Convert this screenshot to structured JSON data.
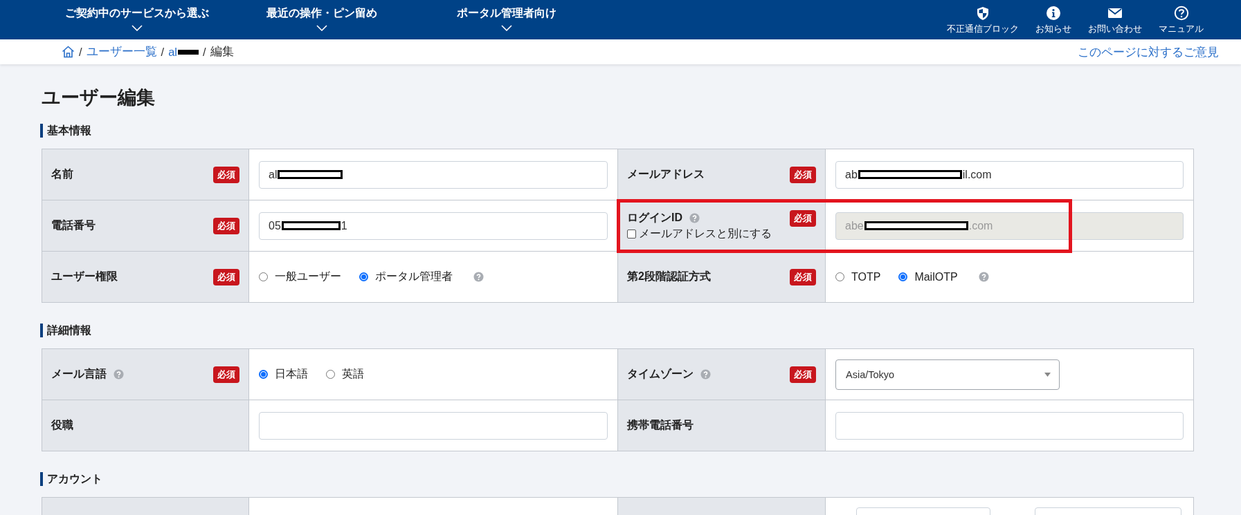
{
  "header": {
    "nav": [
      {
        "label": "ご契約中のサービスから選ぶ"
      },
      {
        "label": "最近の操作・ピン留め"
      },
      {
        "label": "ポータル管理者向け"
      }
    ],
    "utilities": [
      {
        "kind": "shield",
        "label": "不正通信ブロック"
      },
      {
        "kind": "info",
        "label": "お知らせ"
      },
      {
        "kind": "mail",
        "label": "お問い合わせ"
      },
      {
        "kind": "help",
        "label": "マニュアル"
      }
    ]
  },
  "breadcrumb": {
    "items": [
      {
        "kind": "home"
      },
      {
        "kind": "separator",
        "label": "/"
      },
      {
        "kind": "link",
        "label": "ユーザー一覧"
      },
      {
        "kind": "separator",
        "label": "/"
      },
      {
        "kind": "link",
        "label": "al",
        "redacted": true
      },
      {
        "kind": "separator",
        "label": "/"
      },
      {
        "kind": "current",
        "label": "編集"
      }
    ],
    "feedback_link": "このページに対するご意見"
  },
  "page_title": "ユーザー編集",
  "sections": [
    {
      "title": "基本情報",
      "rows": [
        [
          {
            "label": "名前",
            "required": "必須",
            "control": {
              "kind": "text",
              "value": "al",
              "redacted": true
            }
          },
          {
            "label": "メールアドレス",
            "required": "必須",
            "control": {
              "kind": "text",
              "value": "ab",
              "redacted": true,
              "value_end": "il.com"
            }
          }
        ],
        [
          {
            "label": "電話番号",
            "required": "必須",
            "control": {
              "kind": "text",
              "value": "05",
              "redacted": true,
              "value_end": "1"
            }
          },
          {
            "label": "ログインID",
            "help": true,
            "required": "必須",
            "highlighted": true,
            "checkbox": {
              "label": "メールアドレスと別にする",
              "checked": false
            },
            "control": {
              "kind": "text",
              "value": "abe",
              "redacted": true,
              "value_end": ".com",
              "disabled": true
            }
          }
        ],
        [
          {
            "label": "ユーザー権限",
            "required": "必須",
            "control": {
              "kind": "radio",
              "help": true,
              "options": [
                {
                  "label": "一般ユーザー",
                  "selected": false
                },
                {
                  "label": "ポータル管理者",
                  "selected": true
                }
              ]
            }
          },
          {
            "label": "第2段階認証方式",
            "required": "必須",
            "control": {
              "kind": "radio",
              "help": true,
              "options": [
                {
                  "label": "TOTP",
                  "selected": false
                },
                {
                  "label": "MailOTP",
                  "selected": true
                }
              ]
            }
          }
        ]
      ]
    },
    {
      "title": "詳細情報",
      "rows": [
        [
          {
            "label": "メール言語",
            "help": true,
            "required": "必須",
            "control": {
              "kind": "radio",
              "options": [
                {
                  "label": "日本語",
                  "selected": true
                },
                {
                  "label": "英語",
                  "selected": false
                }
              ]
            }
          },
          {
            "label": "タイムゾーン",
            "help": true,
            "required": "必須",
            "control": {
              "kind": "select",
              "value": "Asia/Tokyo"
            }
          }
        ],
        [
          {
            "label": "役職",
            "control": {
              "kind": "text"
            }
          },
          {
            "label": "携帯電話番号",
            "control": {
              "kind": "text"
            }
          }
        ]
      ]
    },
    {
      "title": "アカウント",
      "rows": [
        [
          {
            "control": {
              "kind": "empty"
            }
          },
          {
            "control": {
              "kind": "pair"
            }
          }
        ]
      ]
    }
  ]
}
